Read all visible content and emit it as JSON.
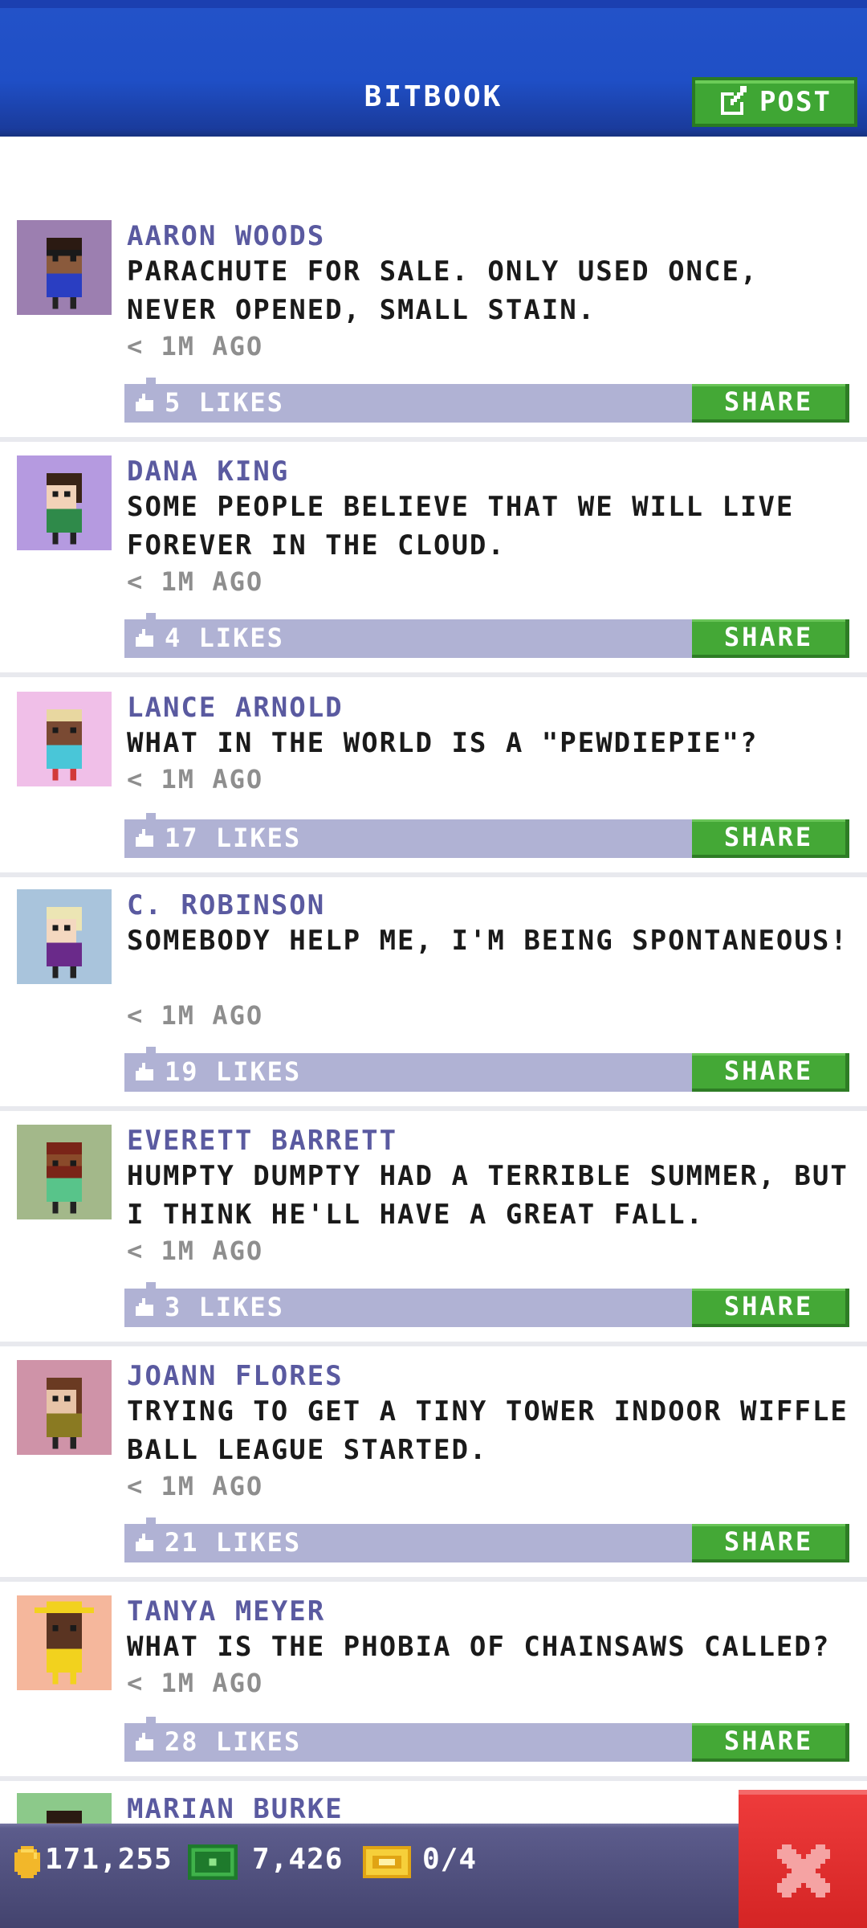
{
  "header": {
    "title": "BITBOOK",
    "post_label": "POST"
  },
  "posts": [
    {
      "name": "AARON WOODS",
      "message": "PARACHUTE FOR SALE. ONLY USED ONCE, NEVER OPENED, SMALL STAIN.",
      "time": "< 1M AGO",
      "likes": "5 LIKES",
      "share": "SHARE",
      "avatar_bg": "#9c7fb0",
      "skin": "#8a5a3c",
      "hair": "#2b1a12",
      "shirt": "#2a3ec2"
    },
    {
      "name": "DANA KING",
      "message": "SOME PEOPLE BELIEVE THAT WE WILL LIVE FOREVER IN THE CLOUD.",
      "time": "< 1M AGO",
      "likes": "4 LIKES",
      "share": "SHARE",
      "avatar_bg": "#b59ae0",
      "skin": "#f2d2b8",
      "hair": "#3a2416",
      "shirt": "#2f8a4a"
    },
    {
      "name": "LANCE ARNOLD",
      "message": "WHAT IN THE WORLD IS A \"PEWDIEPIE\"?",
      "time": "< 1M AGO",
      "likes": "17 LIKES",
      "share": "SHARE",
      "avatar_bg": "#f0bfe8",
      "skin": "#7a4a33",
      "hair": "#e8d7a0",
      "shirt": "#49c6d8"
    },
    {
      "name": "C. ROBINSON",
      "message": "SOMEBODY HELP ME, I'M BEING SPONTANEOUS!",
      "time": "< 1M AGO",
      "likes": "19 LIKES",
      "share": "SHARE",
      "avatar_bg": "#a9c4dc",
      "skin": "#f4d8c0",
      "hair": "#ece5b4",
      "shirt": "#6a2a8a"
    },
    {
      "name": "EVERETT BARRETT",
      "message": "HUMPTY DUMPTY HAD A TERRIBLE SUMMER, BUT I THINK HE'LL HAVE A GREAT FALL.",
      "time": "< 1M AGO",
      "likes": "3 LIKES",
      "share": "SHARE",
      "avatar_bg": "#a3b88a",
      "skin": "#8a4a2a",
      "hair": "#7a2418",
      "shirt": "#58c48a"
    },
    {
      "name": "JOANN FLORES",
      "message": "TRYING TO GET A TINY TOWER INDOOR WIFFLE BALL LEAGUE STARTED.",
      "time": "< 1M AGO",
      "likes": "21 LIKES",
      "share": "SHARE",
      "avatar_bg": "#cf93a8",
      "skin": "#e8c4a8",
      "hair": "#6a3a22",
      "shirt": "#8a7a22"
    },
    {
      "name": "TANYA MEYER",
      "message": "WHAT IS THE PHOBIA OF CHAINSAWS CALLED?",
      "time": "< 1M AGO",
      "likes": "28 LIKES",
      "share": "SHARE",
      "avatar_bg": "#f5b79c",
      "skin": "#5a3422",
      "hair": "#f2d21e",
      "shirt": "#f2d21e"
    },
    {
      "name": "MARIAN BURKE",
      "avatar_bg": "#8cc98a",
      "skin": "#6a4a36",
      "hair": "#2a1a12",
      "shirt": "#888888"
    }
  ],
  "footer": {
    "coins": "171,255",
    "bux": "7,426",
    "tickets": "0/4"
  },
  "colors": {
    "header": "#1f4fc6",
    "name": "#5a5aa0",
    "likes_bar": "#b0b2d4",
    "share": "#44a836",
    "close": "#e23030"
  }
}
